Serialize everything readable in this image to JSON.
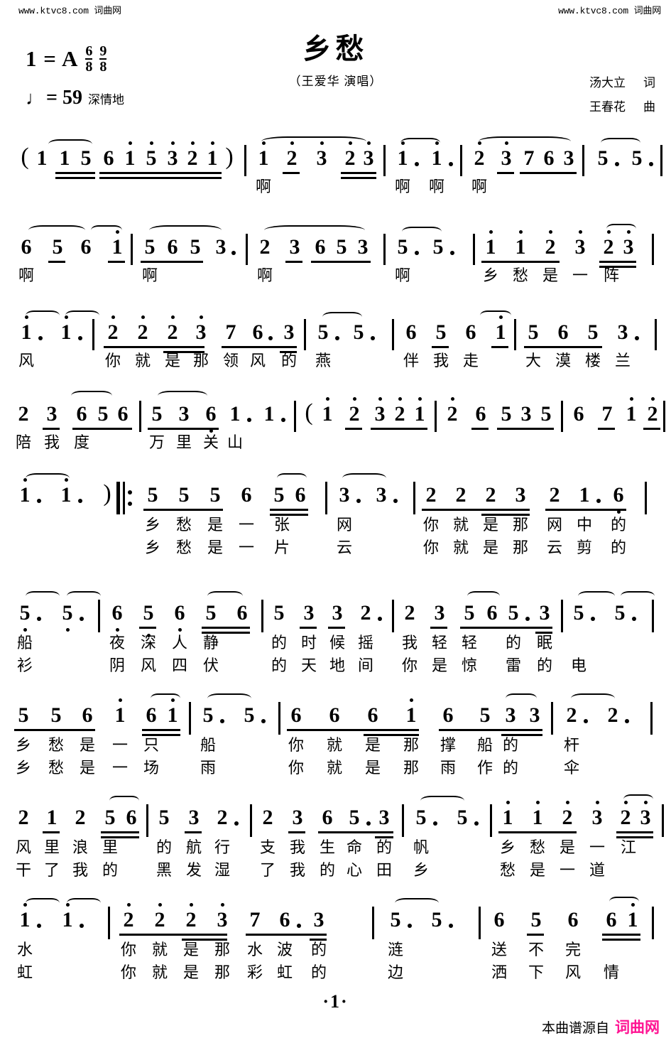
{
  "watermark": {
    "left": "www.ktvc8.com 词曲网",
    "right": "www.ktvc8.com 词曲网"
  },
  "header": {
    "title": "乡愁",
    "singer": "（王爱华 演唱）",
    "lyricist_name": "汤大立",
    "lyricist_role": "词",
    "composer_name": "王春花",
    "composer_role": "曲",
    "key_label": "1 = A",
    "meter_1_num": "6",
    "meter_1_den": "8",
    "meter_2_num": "9",
    "meter_2_den": "8",
    "tempo_note": "♩",
    "tempo_eq": "= 59",
    "mood": "深情地"
  },
  "footer": {
    "page_number": "·1·",
    "source_prefix": "本曲谱源自",
    "source_brand": "词曲网"
  },
  "score": {
    "lines": [
      {
        "id": "line-1",
        "notes": [
          "(",
          "1",
          "1",
          "5",
          "6",
          "1",
          "5",
          "3",
          "2",
          "1",
          ")",
          "1",
          "2",
          "3",
          "2",
          "3",
          "1·",
          "1·",
          "2",
          "3",
          "7",
          "6",
          "3",
          "5·",
          "5·"
        ],
        "lyrics_1": [
          "啊",
          "啊",
          "啊",
          "啊"
        ]
      },
      {
        "id": "line-2",
        "notes": [
          "6",
          "5",
          "6",
          "1",
          "5",
          "6",
          "5",
          "3·",
          "2",
          "3",
          "6",
          "5",
          "3",
          "5·",
          "5·",
          "1",
          "1",
          "2",
          "3",
          "2",
          "3"
        ],
        "lyrics_1": [
          "啊",
          "啊",
          "啊",
          "啊",
          "乡",
          "愁",
          "是",
          "一",
          "阵"
        ]
      },
      {
        "id": "line-3",
        "notes": [
          "1·",
          "1·",
          "2",
          "2",
          "2",
          "3",
          "7",
          "6·",
          "3",
          "5·",
          "5·",
          "6",
          "5",
          "6",
          "1",
          "5",
          "6",
          "5",
          "3·"
        ],
        "lyrics_1": [
          "风",
          "你",
          "就",
          "是",
          "那",
          "领",
          "风",
          "的",
          "燕",
          "伴",
          "我",
          "走",
          "大",
          "漠",
          "楼",
          "兰"
        ]
      },
      {
        "id": "line-4",
        "notes": [
          "2",
          "3",
          "6",
          "5",
          "6",
          "5",
          "3",
          "6",
          "1·",
          "1·",
          "(",
          "1",
          "2",
          "3",
          "2",
          "1",
          "2",
          "6",
          "5",
          "3",
          "5",
          "6",
          "7",
          "1",
          "2"
        ],
        "lyrics_1": [
          "陪",
          "我",
          "度",
          "万",
          "里",
          "关",
          "山"
        ]
      },
      {
        "id": "line-5",
        "notes": [
          "1·",
          "1·",
          ")",
          "5",
          "5",
          "5",
          "6",
          "5",
          "6",
          "3·",
          "3·",
          "2",
          "2",
          "2",
          "3",
          "2",
          "1·",
          "6"
        ],
        "lyrics_1": [
          "乡",
          "愁",
          "是",
          "一",
          "张",
          "网",
          "你",
          "就",
          "是",
          "那",
          "网",
          "中",
          "的"
        ],
        "lyrics_2": [
          "乡",
          "愁",
          "是",
          "一",
          "片",
          "云",
          "你",
          "就",
          "是",
          "那",
          "云",
          "剪",
          "的"
        ]
      },
      {
        "id": "line-6",
        "notes": [
          "5·",
          "5·",
          "6",
          "5",
          "6",
          "5",
          "6",
          "5",
          "3",
          "3",
          "2·",
          "2",
          "3",
          "5",
          "6",
          "5·",
          "3",
          "5·",
          "5·"
        ],
        "lyrics_1": [
          "船",
          "夜",
          "深",
          "人",
          "静",
          "的",
          "时",
          "候",
          "摇",
          "我",
          "轻",
          "轻",
          "的",
          "眠"
        ],
        "lyrics_2": [
          "衫",
          "阴",
          "风",
          "四",
          "伏",
          "的",
          "天",
          "地",
          "间",
          "你",
          "是",
          "惊",
          "雷",
          "的",
          "电"
        ]
      },
      {
        "id": "line-7",
        "notes": [
          "5",
          "5",
          "6",
          "1",
          "6",
          "1",
          "5·",
          "5·",
          "6",
          "6",
          "6",
          "1",
          "6",
          "5",
          "3",
          "3",
          "2·",
          "2·"
        ],
        "lyrics_1": [
          "乡",
          "愁",
          "是",
          "一",
          "只",
          "船",
          "你",
          "就",
          "是",
          "那",
          "撑",
          "船",
          "的",
          "杆"
        ],
        "lyrics_2": [
          "乡",
          "愁",
          "是",
          "一",
          "场",
          "雨",
          "你",
          "就",
          "是",
          "那",
          "雨",
          "作",
          "的",
          "伞"
        ]
      },
      {
        "id": "line-8",
        "notes": [
          "2",
          "1",
          "2",
          "5",
          "6",
          "5",
          "3",
          "2·",
          "2",
          "3",
          "6",
          "5·",
          "3",
          "5·",
          "5·",
          "1",
          "1",
          "2",
          "3",
          "2",
          "3"
        ],
        "lyrics_1": [
          "风",
          "里",
          "浪",
          "里",
          "的",
          "航",
          "行",
          "支",
          "我",
          "生",
          "命",
          "的",
          "帆",
          "乡",
          "愁",
          "是",
          "一",
          "江"
        ],
        "lyrics_2": [
          "干",
          "了",
          "我",
          "的",
          "黑",
          "发",
          "湿",
          "了",
          "我",
          "的",
          "心",
          "田",
          "乡",
          "愁",
          "是",
          "一",
          "道"
        ]
      },
      {
        "id": "line-9",
        "notes": [
          "1·",
          "1·",
          "2",
          "2",
          "2",
          "3",
          "7",
          "6·",
          "3",
          "5·",
          "5·",
          "6",
          "5",
          "6",
          "6",
          "1"
        ],
        "lyrics_1": [
          "水",
          "你",
          "就",
          "是",
          "那",
          "水",
          "波",
          "的",
          "涟",
          "送",
          "不",
          "完"
        ],
        "lyrics_2": [
          "虹",
          "你",
          "就",
          "是",
          "那",
          "彩",
          "虹",
          "的",
          "边",
          "洒",
          "下",
          "风",
          "情"
        ]
      }
    ]
  }
}
